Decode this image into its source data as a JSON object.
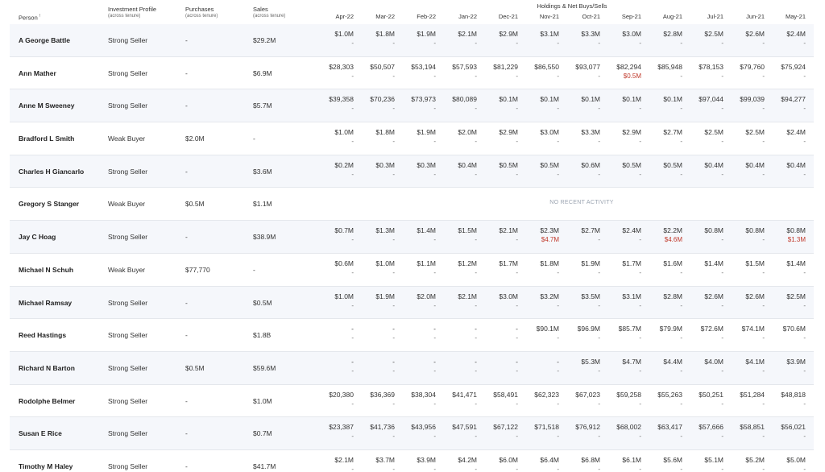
{
  "header": {
    "group_title": "Holdings & Net Buys/Sells",
    "person": "Person",
    "sort_glyph": "↑",
    "profile": "Investment Profile",
    "profile_sub": "(across tenure)",
    "purchases": "Purchases",
    "purchases_sub": "(across tenure)",
    "sales": "Sales",
    "sales_sub": "(across tenure)",
    "months": [
      "Apr-22",
      "Mar-22",
      "Feb-22",
      "Jan-22",
      "Dec-21",
      "Nov-21",
      "Oct-21",
      "Sep-21",
      "Aug-21",
      "Jul-21",
      "Jun-21",
      "May-21"
    ]
  },
  "no_activity_label": "NO RECENT ACTIVITY",
  "rows": [
    {
      "person": "A George Battle",
      "profile": "Strong Seller",
      "purchases": "-",
      "sales": "$29.2M",
      "vals": [
        "$1.0M",
        "$1.8M",
        "$1.9M",
        "$2.1M",
        "$2.9M",
        "$3.1M",
        "$3.3M",
        "$3.0M",
        "$2.8M",
        "$2.5M",
        "$2.6M",
        "$2.4M"
      ],
      "subs": [
        "-",
        "-",
        "-",
        "-",
        "-",
        "-",
        "-",
        "-",
        "-",
        "-",
        "-",
        "-"
      ]
    },
    {
      "person": "Ann Mather",
      "profile": "Strong Seller",
      "purchases": "-",
      "sales": "$6.9M",
      "vals": [
        "$28,303",
        "$50,507",
        "$53,194",
        "$57,593",
        "$81,229",
        "$86,550",
        "$93,077",
        "$82,294",
        "$85,948",
        "$78,153",
        "$79,760",
        "$75,924"
      ],
      "subs": [
        "-",
        "-",
        "-",
        "-",
        "-",
        "-",
        "-",
        "$0.5M",
        "-",
        "-",
        "-",
        "-"
      ]
    },
    {
      "person": "Anne M Sweeney",
      "profile": "Strong Seller",
      "purchases": "-",
      "sales": "$5.7M",
      "vals": [
        "$39,358",
        "$70,236",
        "$73,973",
        "$80,089",
        "$0.1M",
        "$0.1M",
        "$0.1M",
        "$0.1M",
        "$0.1M",
        "$97,044",
        "$99,039",
        "$94,277"
      ],
      "subs": [
        "-",
        "-",
        "-",
        "-",
        "-",
        "-",
        "-",
        "-",
        "-",
        "-",
        "-",
        "-"
      ]
    },
    {
      "person": "Bradford L Smith",
      "profile": "Weak Buyer",
      "purchases": "$2.0M",
      "sales": "-",
      "vals": [
        "$1.0M",
        "$1.8M",
        "$1.9M",
        "$2.0M",
        "$2.9M",
        "$3.0M",
        "$3.3M",
        "$2.9M",
        "$2.7M",
        "$2.5M",
        "$2.5M",
        "$2.4M"
      ],
      "subs": [
        "-",
        "-",
        "-",
        "-",
        "-",
        "-",
        "-",
        "-",
        "-",
        "-",
        "-",
        "-"
      ]
    },
    {
      "person": "Charles H Giancarlo",
      "profile": "Strong Seller",
      "purchases": "-",
      "sales": "$3.6M",
      "vals": [
        "$0.2M",
        "$0.3M",
        "$0.3M",
        "$0.4M",
        "$0.5M",
        "$0.5M",
        "$0.6M",
        "$0.5M",
        "$0.5M",
        "$0.4M",
        "$0.4M",
        "$0.4M"
      ],
      "subs": [
        "-",
        "-",
        "-",
        "-",
        "-",
        "-",
        "-",
        "-",
        "-",
        "-",
        "-",
        "-"
      ]
    },
    {
      "person": "Gregory S Stanger",
      "profile": "Weak Buyer",
      "purchases": "$0.5M",
      "sales": "$1.1M",
      "no_activity": true,
      "vals": [],
      "subs": []
    },
    {
      "person": "Jay C Hoag",
      "profile": "Strong Seller",
      "purchases": "-",
      "sales": "$38.9M",
      "vals": [
        "$0.7M",
        "$1.3M",
        "$1.4M",
        "$1.5M",
        "$2.1M",
        "$2.3M",
        "$2.7M",
        "$2.4M",
        "$2.2M",
        "$0.8M",
        "$0.8M",
        "$0.8M"
      ],
      "subs": [
        "-",
        "-",
        "-",
        "-",
        "-",
        "$4.7M",
        "-",
        "-",
        "$4.6M",
        "-",
        "-",
        "$1.3M"
      ]
    },
    {
      "person": "Michael N Schuh",
      "profile": "Weak Buyer",
      "purchases": "$77,770",
      "sales": "-",
      "vals": [
        "$0.6M",
        "$1.0M",
        "$1.1M",
        "$1.2M",
        "$1.7M",
        "$1.8M",
        "$1.9M",
        "$1.7M",
        "$1.6M",
        "$1.4M",
        "$1.5M",
        "$1.4M"
      ],
      "subs": [
        "-",
        "-",
        "-",
        "-",
        "-",
        "-",
        "-",
        "-",
        "-",
        "-",
        "-",
        "-"
      ]
    },
    {
      "person": "Michael Ramsay",
      "profile": "Strong Seller",
      "purchases": "-",
      "sales": "$0.5M",
      "vals": [
        "$1.0M",
        "$1.9M",
        "$2.0M",
        "$2.1M",
        "$3.0M",
        "$3.2M",
        "$3.5M",
        "$3.1M",
        "$2.8M",
        "$2.6M",
        "$2.6M",
        "$2.5M"
      ],
      "subs": [
        "-",
        "-",
        "-",
        "-",
        "-",
        "-",
        "-",
        "-",
        "-",
        "-",
        "-",
        "-"
      ]
    },
    {
      "person": "Reed Hastings",
      "profile": "Strong Seller",
      "purchases": "-",
      "sales": "$1.8B",
      "vals": [
        "-",
        "-",
        "-",
        "-",
        "-",
        "$90.1M",
        "$96.9M",
        "$85.7M",
        "$79.9M",
        "$72.6M",
        "$74.1M",
        "$70.6M"
      ],
      "subs": [
        "-",
        "-",
        "-",
        "-",
        "-",
        "-",
        "-",
        "-",
        "-",
        "-",
        "-",
        "-"
      ]
    },
    {
      "person": "Richard N Barton",
      "profile": "Strong Seller",
      "purchases": "$0.5M",
      "sales": "$59.6M",
      "vals": [
        "-",
        "-",
        "-",
        "-",
        "-",
        "-",
        "$5.3M",
        "$4.7M",
        "$4.4M",
        "$4.0M",
        "$4.1M",
        "$3.9M"
      ],
      "subs": [
        "-",
        "-",
        "-",
        "-",
        "-",
        "-",
        "-",
        "-",
        "-",
        "-",
        "-",
        "-"
      ]
    },
    {
      "person": "Rodolphe Belmer",
      "profile": "Strong Seller",
      "purchases": "-",
      "sales": "$1.0M",
      "vals": [
        "$20,380",
        "$36,369",
        "$38,304",
        "$41,471",
        "$58,491",
        "$62,323",
        "$67,023",
        "$59,258",
        "$55,263",
        "$50,251",
        "$51,284",
        "$48,818"
      ],
      "subs": [
        "-",
        "-",
        "-",
        "-",
        "-",
        "-",
        "-",
        "-",
        "-",
        "-",
        "-",
        "-"
      ]
    },
    {
      "person": "Susan E Rice",
      "profile": "Strong Seller",
      "purchases": "-",
      "sales": "$0.7M",
      "vals": [
        "$23,387",
        "$41,736",
        "$43,956",
        "$47,591",
        "$67,122",
        "$71,518",
        "$76,912",
        "$68,002",
        "$63,417",
        "$57,666",
        "$58,851",
        "$56,021"
      ],
      "subs": [
        "-",
        "-",
        "-",
        "-",
        "-",
        "-",
        "-",
        "-",
        "-",
        "-",
        "-",
        "-"
      ]
    },
    {
      "person": "Timothy M Haley",
      "profile": "Strong Seller",
      "purchases": "-",
      "sales": "$41.7M",
      "vals": [
        "$2.1M",
        "$3.7M",
        "$3.9M",
        "$4.2M",
        "$6.0M",
        "$6.4M",
        "$6.8M",
        "$6.1M",
        "$5.6M",
        "$5.1M",
        "$5.2M",
        "$5.0M"
      ],
      "subs": [
        "-",
        "-",
        "-",
        "-",
        "-",
        "-",
        "-",
        "-",
        "-",
        "-",
        "-",
        "-"
      ]
    }
  ]
}
